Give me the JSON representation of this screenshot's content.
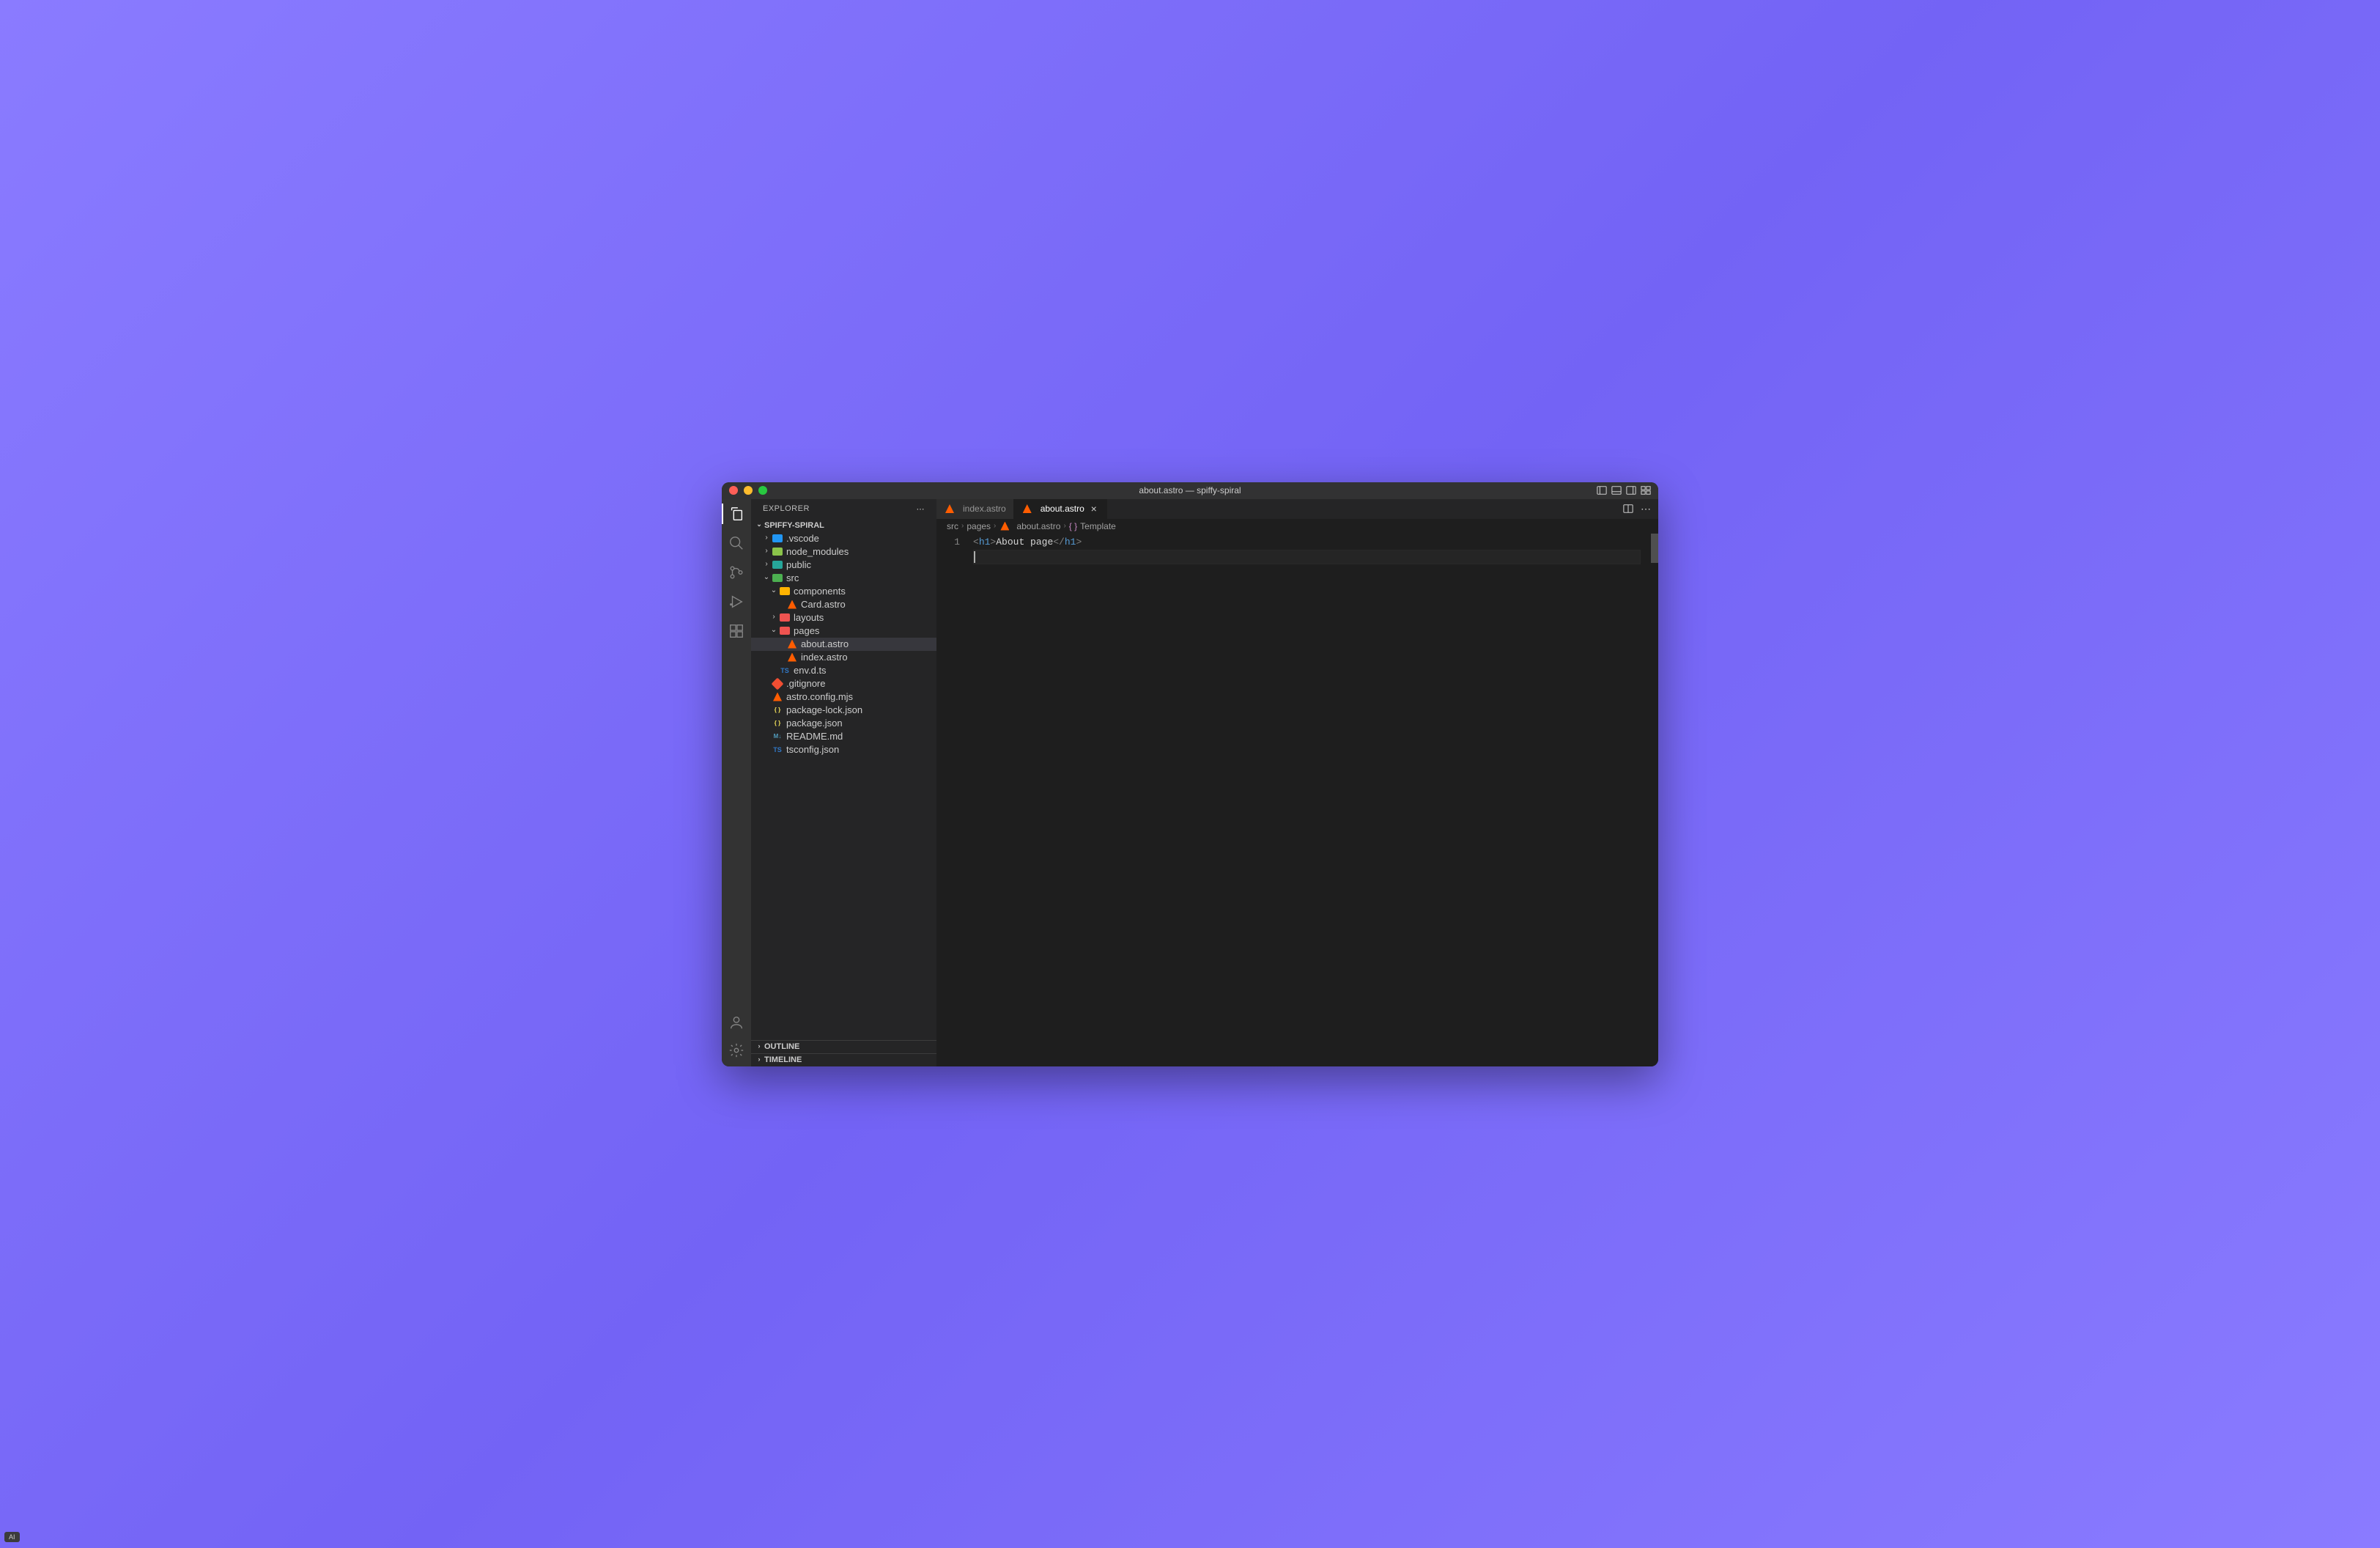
{
  "window": {
    "title": "about.astro — spiffy-spiral"
  },
  "sidebar": {
    "header": "EXPLORER",
    "project": "SPIFFY-SPIRAL",
    "tree": [
      {
        "name": ".vscode",
        "indent": 1,
        "icon": "folder-vscode",
        "twisty": "right"
      },
      {
        "name": "node_modules",
        "indent": 1,
        "icon": "folder-node",
        "twisty": "right"
      },
      {
        "name": "public",
        "indent": 1,
        "icon": "folder-pub",
        "twisty": "right"
      },
      {
        "name": "src",
        "indent": 1,
        "icon": "folder-src",
        "twisty": "down"
      },
      {
        "name": "components",
        "indent": 2,
        "icon": "folder-comp",
        "twisty": "down"
      },
      {
        "name": "Card.astro",
        "indent": 3,
        "icon": "astro",
        "twisty": ""
      },
      {
        "name": "layouts",
        "indent": 2,
        "icon": "folder-layout",
        "twisty": "right"
      },
      {
        "name": "pages",
        "indent": 2,
        "icon": "folder-pages",
        "twisty": "down"
      },
      {
        "name": "about.astro",
        "indent": 3,
        "icon": "astro",
        "twisty": "",
        "selected": true
      },
      {
        "name": "index.astro",
        "indent": 3,
        "icon": "astro",
        "twisty": ""
      },
      {
        "name": "env.d.ts",
        "indent": 2,
        "icon": "ts",
        "twisty": ""
      },
      {
        "name": ".gitignore",
        "indent": 1,
        "icon": "git",
        "twisty": ""
      },
      {
        "name": "astro.config.mjs",
        "indent": 1,
        "icon": "astro",
        "twisty": ""
      },
      {
        "name": "package-lock.json",
        "indent": 1,
        "icon": "json",
        "twisty": ""
      },
      {
        "name": "package.json",
        "indent": 1,
        "icon": "json",
        "twisty": ""
      },
      {
        "name": "README.md",
        "indent": 1,
        "icon": "md",
        "twisty": ""
      },
      {
        "name": "tsconfig.json",
        "indent": 1,
        "icon": "ts",
        "twisty": ""
      }
    ],
    "sections": {
      "outline": "OUTLINE",
      "timeline": "TIMELINE"
    }
  },
  "tabs": [
    {
      "label": "index.astro",
      "active": false
    },
    {
      "label": "about.astro",
      "active": true
    }
  ],
  "breadcrumbs": {
    "parts": [
      "src",
      "pages",
      "about.astro",
      "Template"
    ]
  },
  "editor": {
    "lineNumber": "1",
    "code": {
      "open_bracket": "<",
      "tag": "h1",
      "gt": ">",
      "text": "About page",
      "close_open": "</",
      "close_tag": "h1",
      "close_gt": ">"
    }
  },
  "ai_badge": "AI"
}
